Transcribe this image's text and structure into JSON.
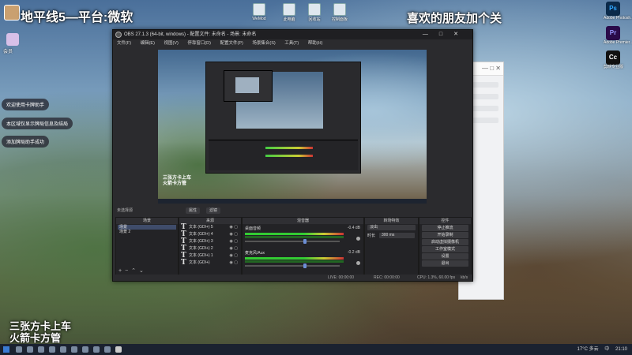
{
  "desktop": {
    "banner_left": "地平线5—平台:微软",
    "banner_right": "喜欢的朋友加个关",
    "avatar_label": "会员",
    "bottom_line1": "三张方卡上车",
    "bottom_line2": "火箭卡方管",
    "top_icons": [
      "WeMod",
      "此电脑",
      "回收站",
      "控制面板"
    ],
    "right_dock": [
      {
        "abbr": "Ps",
        "label": "Adobe Photosh...",
        "color": "#0b2a4a"
      },
      {
        "abbr": "Pr",
        "label": "Adobe Premier...",
        "color": "#2a0b4a"
      },
      {
        "abbr": "Cc",
        "label": "剪映专业版",
        "color": "#111111"
      }
    ],
    "notifications": [
      "欢迎使用卡牌助手",
      "本区域仅显示牌局信息及结局",
      "添加牌局助手成功"
    ]
  },
  "obs": {
    "title": "OBS 27.1.3 (64-bit, windows) - 配置文件: 未命名 - 场景: 未命名",
    "menu": [
      "文件(F)",
      "编辑(E)",
      "视图(V)",
      "停靠窗口(D)",
      "配置文件(P)",
      "场景集合(S)",
      "工具(T)",
      "帮助(H)"
    ],
    "preview_caption_1": "三张方卡上车",
    "preview_caption_2": "火箭卡方管",
    "context_label": "未选择源",
    "context_buttons": [
      "属性",
      "滤镜"
    ],
    "docks": {
      "scenes": {
        "title": "场景",
        "items": [
          "场景",
          "场景 2"
        ]
      },
      "sources": {
        "title": "来源",
        "items": [
          "文本 (GDI+) 5",
          "文本 (GDI+) 4",
          "文本 (GDI+) 3",
          "文本 (GDI+) 2",
          "文本 (GDI+) 1",
          "文本 (GDI+)"
        ]
      },
      "mixer": {
        "title": "混音器",
        "channels": [
          {
            "name": "桌面音频",
            "db": "-0.4 dB",
            "level": 0.62
          },
          {
            "name": "麦克风/Aux",
            "db": "-0.2 dB",
            "level": 0.62
          }
        ]
      },
      "transitions": {
        "title": "转场特效",
        "type_label": "淡出",
        "duration_label": "时长",
        "duration": "300 ms"
      },
      "controls": {
        "title": "控件",
        "buttons": [
          "停止推流",
          "开始录制",
          "启动虚拟摄像机",
          "工作室模式",
          "设置",
          "退出"
        ]
      }
    },
    "status": {
      "live": "LIVE: 00:00:00",
      "rec": "REC: 00:00:00",
      "cpu": "CPU: 1.3%, 60.00 fps",
      "kbps": "kb/s"
    }
  },
  "taskbar": {
    "weather": "17°C 多云",
    "lang": "中",
    "time": "21:10"
  }
}
